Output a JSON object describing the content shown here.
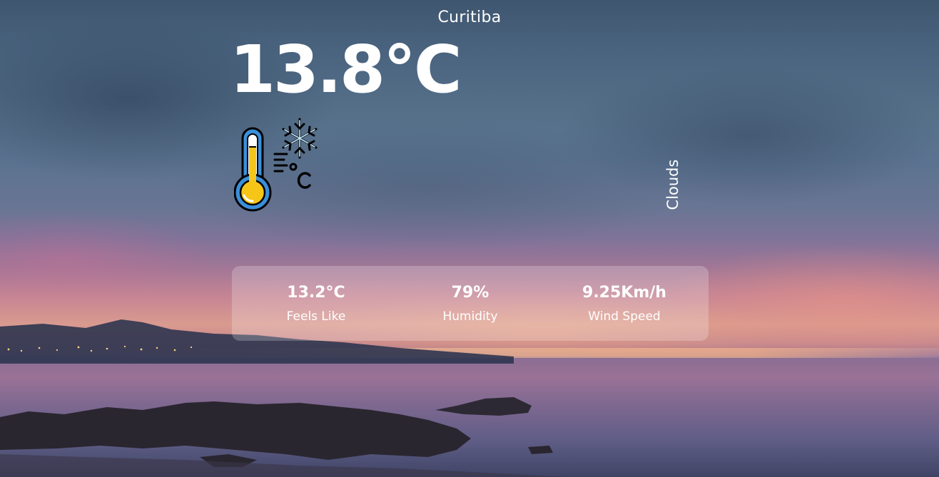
{
  "weather": {
    "city": "Curitiba",
    "temperature": "13.8°C",
    "condition": "Clouds",
    "icon": "thermometer-snowflake-icon"
  },
  "details": {
    "feels_like": {
      "value": "13.2°C",
      "label": "Feels Like"
    },
    "humidity": {
      "value": "79%",
      "label": "Humidity"
    },
    "wind_speed": {
      "value": "9.25Km/h",
      "label": "Wind Speed"
    }
  },
  "colors": {
    "text": "#ffffff",
    "panel": "rgba(255,255,255,0.22)",
    "thermometer_mercury": "#f5c518",
    "thermometer_outline": "#3a8fd9",
    "snowflake": "#bfe3f7"
  }
}
